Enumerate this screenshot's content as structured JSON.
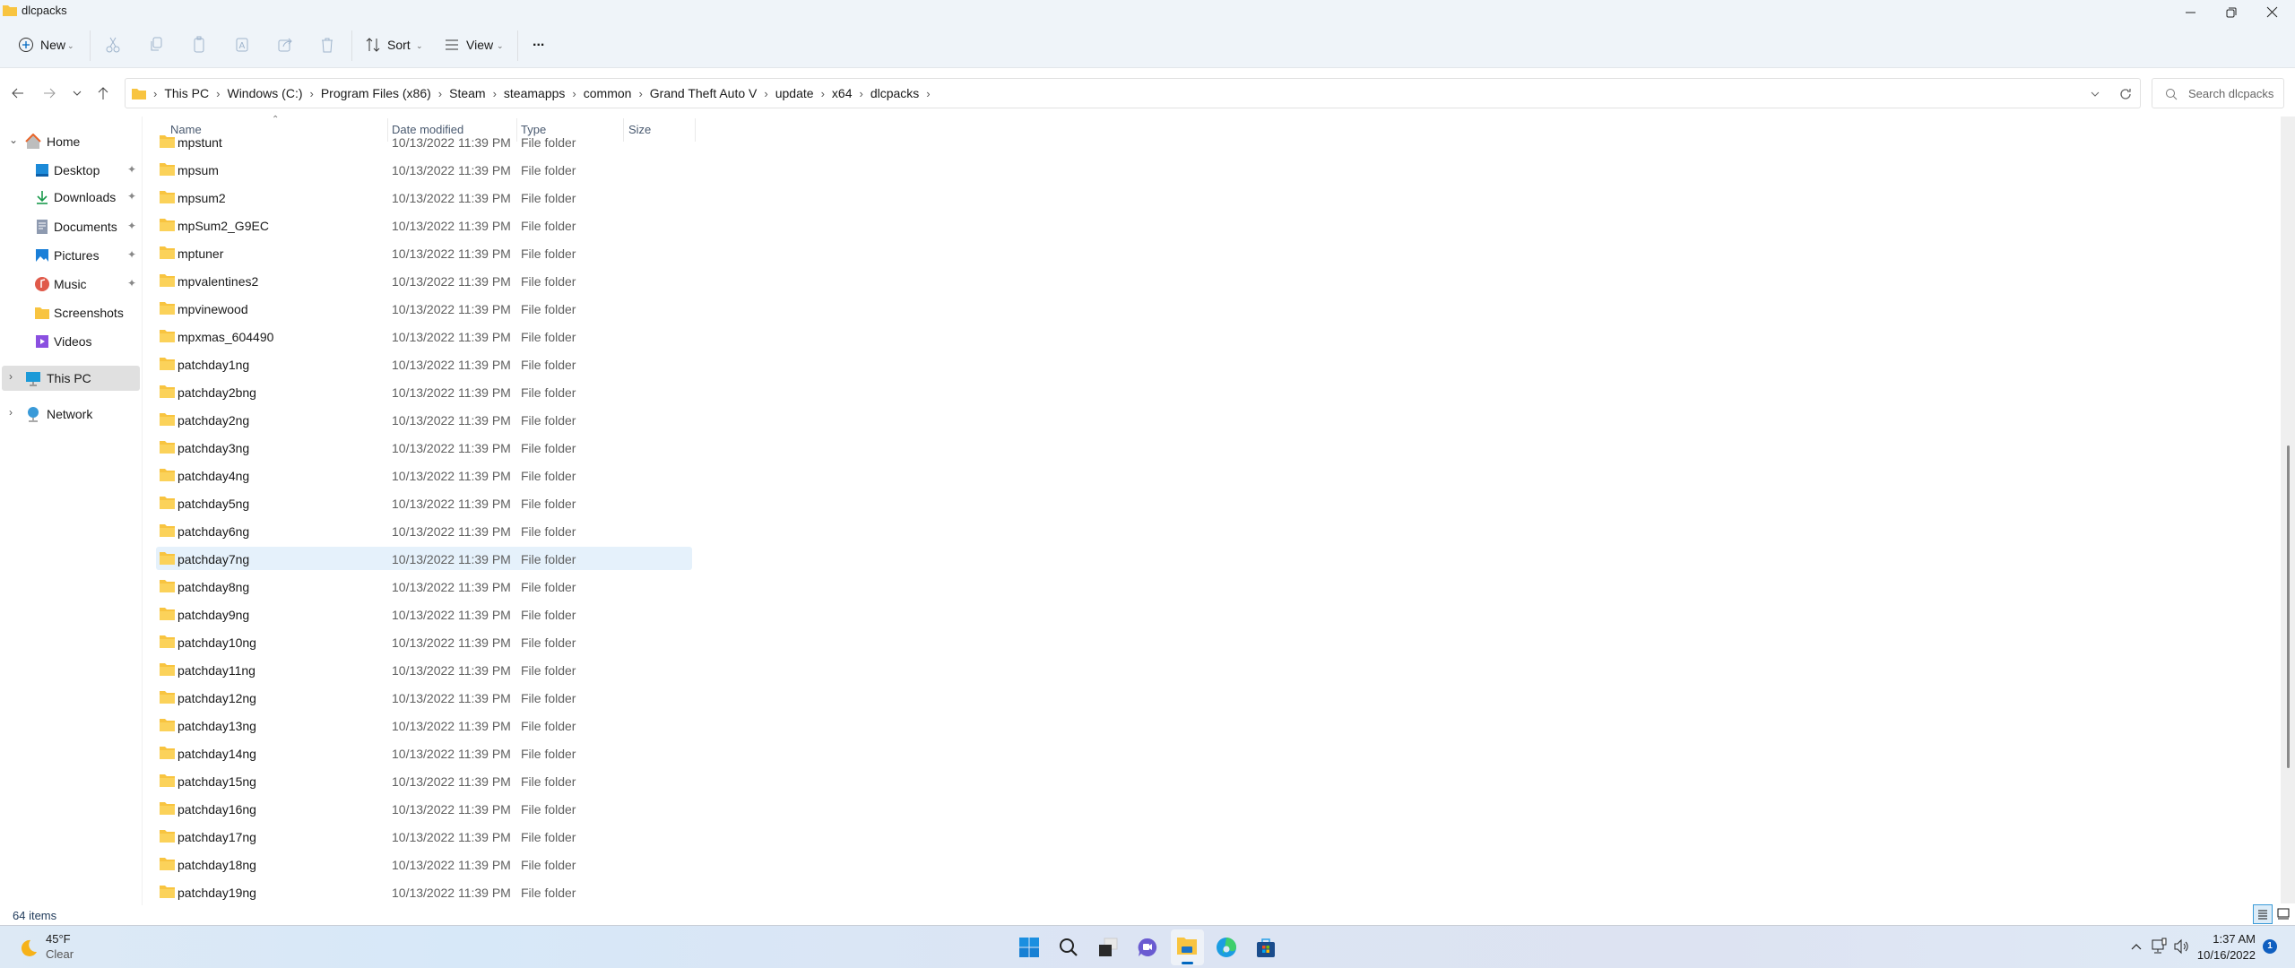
{
  "window": {
    "title": "dlcpacks"
  },
  "toolbar": {
    "new_label": "New",
    "sort_label": "Sort",
    "view_label": "View",
    "more_label": "..."
  },
  "address": {
    "crumbs": [
      "This PC",
      "Windows (C:)",
      "Program Files (x86)",
      "Steam",
      "steamapps",
      "common",
      "Grand Theft Auto V",
      "update",
      "x64",
      "dlcpacks"
    ],
    "search_placeholder": "Search dlcpacks"
  },
  "sidebar": {
    "items": [
      {
        "label": "Home",
        "icon": "home-icon",
        "pinned": false
      },
      {
        "label": "Desktop",
        "icon": "desktop-icon",
        "pinned": true
      },
      {
        "label": "Downloads",
        "icon": "download-icon",
        "pinned": true
      },
      {
        "label": "Documents",
        "icon": "document-icon",
        "pinned": true
      },
      {
        "label": "Pictures",
        "icon": "pictures-icon",
        "pinned": true
      },
      {
        "label": "Music",
        "icon": "music-icon",
        "pinned": true
      },
      {
        "label": "Screenshots",
        "icon": "folder-icon",
        "pinned": false
      },
      {
        "label": "Videos",
        "icon": "video-icon",
        "pinned": false
      },
      {
        "label": "This PC",
        "icon": "pc-icon",
        "pinned": false,
        "selected": true
      },
      {
        "label": "Network",
        "icon": "network-icon",
        "pinned": false
      }
    ]
  },
  "columns": {
    "name": "Name",
    "date": "Date modified",
    "type": "Type",
    "size": "Size"
  },
  "files": {
    "date": "10/13/2022 11:39 PM",
    "type": "File folder",
    "selected": "patchday7ng",
    "names": [
      "mpstunt",
      "mpsum",
      "mpsum2",
      "mpSum2_G9EC",
      "mptuner",
      "mpvalentines2",
      "mpvinewood",
      "mpxmas_604490",
      "patchday1ng",
      "patchday2bng",
      "patchday2ng",
      "patchday3ng",
      "patchday4ng",
      "patchday5ng",
      "patchday6ng",
      "patchday7ng",
      "patchday8ng",
      "patchday9ng",
      "patchday10ng",
      "patchday11ng",
      "patchday12ng",
      "patchday13ng",
      "patchday14ng",
      "patchday15ng",
      "patchday16ng",
      "patchday17ng",
      "patchday18ng",
      "patchday19ng"
    ]
  },
  "status": {
    "items": "64 items"
  },
  "taskbar": {
    "temp": "45°F",
    "weather": "Clear",
    "time": "1:37 AM",
    "date": "10/16/2022",
    "notifications": "1"
  },
  "colors": {
    "folder": "#f8c440",
    "selection": "#e5f1fb",
    "accent": "#0067c0"
  }
}
